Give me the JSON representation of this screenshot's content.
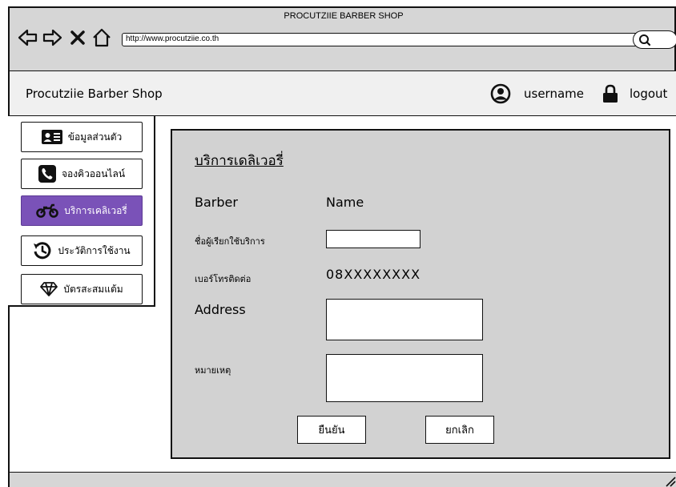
{
  "browser": {
    "window_title": "PROCUTZIIE BARBER SHOP",
    "url": "http://www.procutziie.co.th",
    "icons": [
      "back-arrow-icon",
      "forward-arrow-icon",
      "close-icon",
      "home-icon",
      "search-icon"
    ]
  },
  "header": {
    "app_title": "Procutziie Barber Shop",
    "username": "username",
    "logout": "logout"
  },
  "sidebar": {
    "items": [
      {
        "label": "ข้อมูลส่วนตัว",
        "icon": "id-card-icon",
        "active": false
      },
      {
        "label": "จองคิวออนไลน์",
        "icon": "phone-icon",
        "active": false
      },
      {
        "label": "บริการเคลิเวอรี่",
        "icon": "motorcycle-icon",
        "active": true
      },
      {
        "label": "ประวัติการใช้งาน",
        "icon": "history-icon",
        "active": false
      },
      {
        "label": "บัตรสะสมแต้ม",
        "icon": "diamond-icon",
        "active": false
      }
    ],
    "active_color": "#7a52b8"
  },
  "form": {
    "title": "บริการเดลิเวอรี่",
    "barber_label": "Barber",
    "barber_value": "Name",
    "customer_label": "ชื่อผู้เรียกใช้บริการ",
    "customer_value": "",
    "phone_label": "เบอร์โทรติดต่อ",
    "phone_value": "08XXXXXXXX",
    "address_label": "Address",
    "address_value": "",
    "note_label": "หมายเหตุ",
    "note_value": "",
    "confirm_label": "ยืนยัน",
    "cancel_label": "ยกเลิก"
  }
}
